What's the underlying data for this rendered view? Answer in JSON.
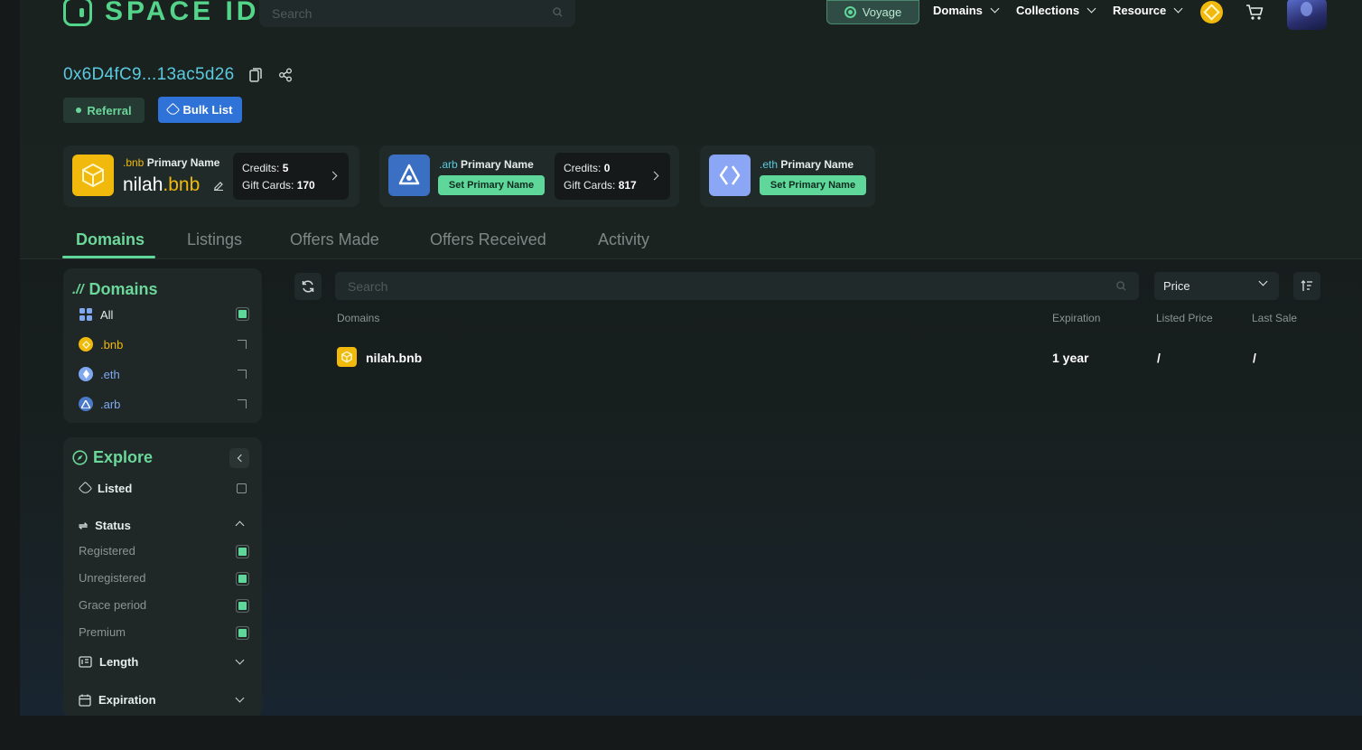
{
  "header": {
    "logo_text": "SPACE ID",
    "search_placeholder": "Search",
    "voyage_label": "Voyage",
    "menus": [
      "Domains",
      "Collections",
      "Resource"
    ]
  },
  "profile": {
    "address": "0x6D4fC9...13ac5d26",
    "referral_label": "Referral",
    "bulk_list_label": "Bulk List"
  },
  "primary_cards": {
    "bnb": {
      "tld": ".bnb",
      "label": "Primary Name",
      "name": "nilah",
      "ext": ".bnb",
      "credits_label": "Credits:",
      "credits_value": "5",
      "gift_label": "Gift Cards:",
      "gift_value": "170"
    },
    "arb": {
      "tld": ".arb",
      "label": "Primary Name",
      "button": "Set Primary Name",
      "credits_label": "Credits:",
      "credits_value": "0",
      "gift_label": "Gift Cards:",
      "gift_value": "817"
    },
    "eth": {
      "tld": ".eth",
      "label": "Primary Name",
      "button": "Set Primary Name"
    }
  },
  "tabs": [
    "Domains",
    "Listings",
    "Offers Made",
    "Offers Received",
    "Activity"
  ],
  "sidebar": {
    "domains_title": "Domains",
    "domain_filters": [
      "All",
      ".bnb",
      ".eth",
      ".arb"
    ],
    "explore_title": "Explore",
    "listed_label": "Listed",
    "status_label": "Status",
    "status_items": [
      "Registered",
      "Unregistered",
      "Grace period",
      "Premium"
    ],
    "length_label": "Length",
    "expiration_label": "Expiration"
  },
  "list": {
    "search_placeholder": "Search",
    "sort_value": "Price",
    "columns": [
      "Domains",
      "Expiration",
      "Listed Price",
      "Last Sale"
    ],
    "rows": [
      {
        "domain": "nilah.bnb",
        "expiration": "1 year",
        "listed_price": "/",
        "last_sale": "/"
      }
    ]
  },
  "colors": {
    "accent_green": "#5fd79a",
    "address_cyan": "#5bc9df",
    "bnb_yellow": "#f0b90b",
    "bulk_blue": "#2f72d8"
  }
}
